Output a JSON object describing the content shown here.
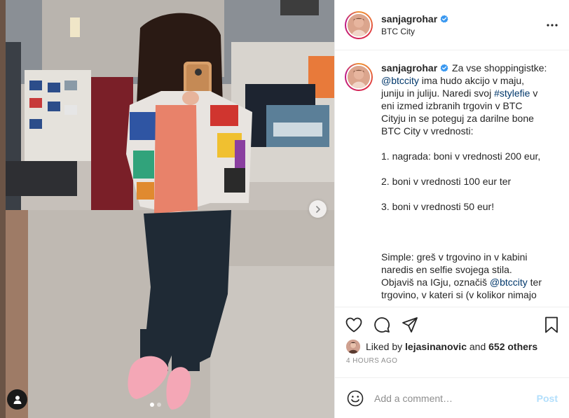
{
  "post": {
    "username": "sanjagrohar",
    "location": "BTC City",
    "verified": true
  },
  "caption": {
    "username": "sanjagrohar",
    "lines": [
      {
        "type": "text",
        "parts": [
          {
            "t": " Za vse shoppingistke:"
          }
        ]
      },
      {
        "type": "text",
        "parts": [
          {
            "t": "@btccity",
            "link": true
          },
          {
            "t": " ima hudo akcijo v maju,"
          }
        ]
      },
      {
        "type": "text",
        "parts": [
          {
            "t": "juniju in juliju. Naredi svoj "
          },
          {
            "t": "#stylefie",
            "link": true
          },
          {
            "t": " v"
          }
        ]
      },
      {
        "type": "text",
        "parts": [
          {
            "t": "eni izmed izbranih trgovin v BTC"
          }
        ]
      },
      {
        "type": "text",
        "parts": [
          {
            "t": "Cityju in se poteguj za darilne bone"
          }
        ]
      },
      {
        "type": "text",
        "parts": [
          {
            "t": "BTC City v vrednosti:"
          }
        ]
      },
      {
        "type": "gap"
      },
      {
        "type": "text",
        "parts": [
          {
            "t": "1. nagrada: boni v vrednosti 200 eur,"
          }
        ]
      },
      {
        "type": "gap"
      },
      {
        "type": "text",
        "parts": [
          {
            "t": "2. boni v vrednosti 100 eur ter"
          }
        ]
      },
      {
        "type": "gap"
      },
      {
        "type": "text",
        "parts": [
          {
            "t": "3. boni v vrednosti 50 eur!"
          }
        ]
      },
      {
        "type": "gap"
      },
      {
        "type": "gap"
      },
      {
        "type": "gap"
      },
      {
        "type": "text",
        "parts": [
          {
            "t": "Simple: greš v trgovino in v kabini"
          }
        ]
      },
      {
        "type": "text",
        "parts": [
          {
            "t": "naredis en selfie svojega stila."
          }
        ]
      },
      {
        "type": "text",
        "parts": [
          {
            "t": "Objaviš na IGju, označiš "
          },
          {
            "t": "@btccity",
            "link": true
          },
          {
            "t": " ter"
          }
        ]
      },
      {
        "type": "text",
        "parts": [
          {
            "t": "trgovino, v kateri si (v kolikor nimajo"
          }
        ]
      }
    ]
  },
  "likes": {
    "prefix": "Liked by ",
    "user": "lejasinanovic",
    "middle": " and ",
    "count": "652 others"
  },
  "timestamp": "4 HOURS AGO",
  "comment_box": {
    "placeholder": "Add a comment…",
    "post_label": "Post"
  },
  "carousel": {
    "total": 2,
    "active": 0
  },
  "icons": {
    "more": "more-options-icon",
    "like": "heart-icon",
    "comment": "comment-icon",
    "share": "share-icon",
    "save": "bookmark-icon",
    "emoji": "emoji-icon",
    "next": "chevron-right-icon",
    "tag": "user-tag-icon"
  },
  "colors": {
    "link": "#00376b",
    "verified": "#3897f0",
    "muted": "#8e8e8e",
    "post_disabled": "#b2dffc"
  }
}
